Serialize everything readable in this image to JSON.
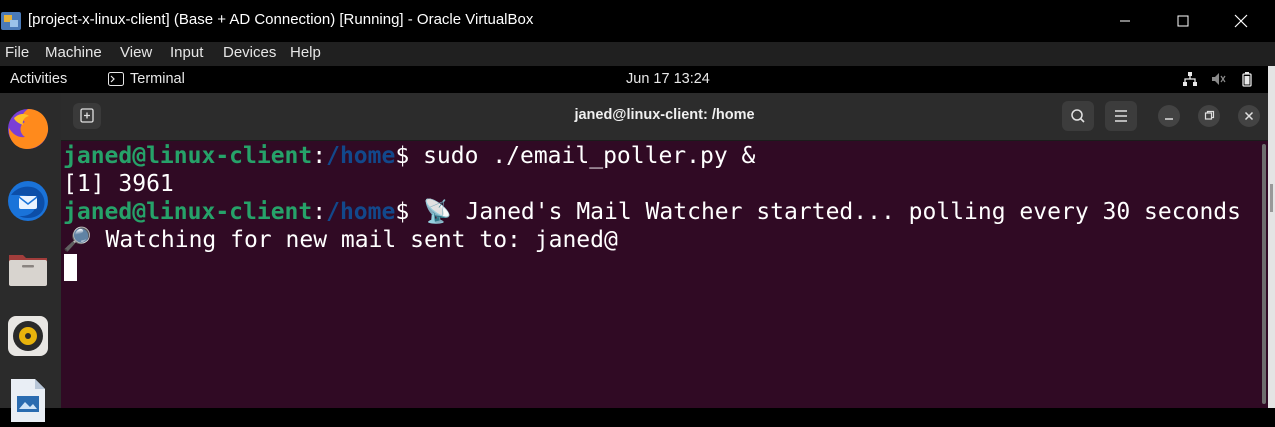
{
  "window": {
    "title": "[project-x-linux-client] (Base + AD Connection) [Running] - Oracle VirtualBox",
    "app_icon": "virtualbox-icon",
    "controls": [
      "minimize-icon",
      "maximize-icon",
      "close-icon"
    ]
  },
  "vbox_menu": {
    "items": [
      "File",
      "Machine",
      "View",
      "Input",
      "Devices",
      "Help"
    ]
  },
  "gnome_bar": {
    "activities": "Activities",
    "app_name": "Terminal",
    "clock": "Jun 17  13:24",
    "tray_icons": [
      "network-icon",
      "volume-muted-icon",
      "battery-icon"
    ]
  },
  "dock": {
    "apps": [
      "firefox-icon",
      "thunderbird-icon",
      "files-icon",
      "rhythmbox-icon",
      "libreoffice-impress-icon"
    ]
  },
  "terminal": {
    "title": "janed@linux-client: /home",
    "prompt_user": "janed@linux-client",
    "prompt_sep": ":",
    "prompt_path": "/home",
    "prompt_sym": "$ ",
    "line1_cmd": "sudo ./email_poller.py &",
    "line2": "[1] 3961",
    "line3_out": "📡 Janed's Mail Watcher started... polling every 30 seconds",
    "line4": "🔎 Watching for new mail sent to: janed@"
  },
  "colors": {
    "terminal_bg": "#300a24",
    "prompt_user": "#26a269",
    "prompt_path": "#12488b",
    "header_bg": "#2c2c2c",
    "dock_bg": "#2b2b2b"
  }
}
